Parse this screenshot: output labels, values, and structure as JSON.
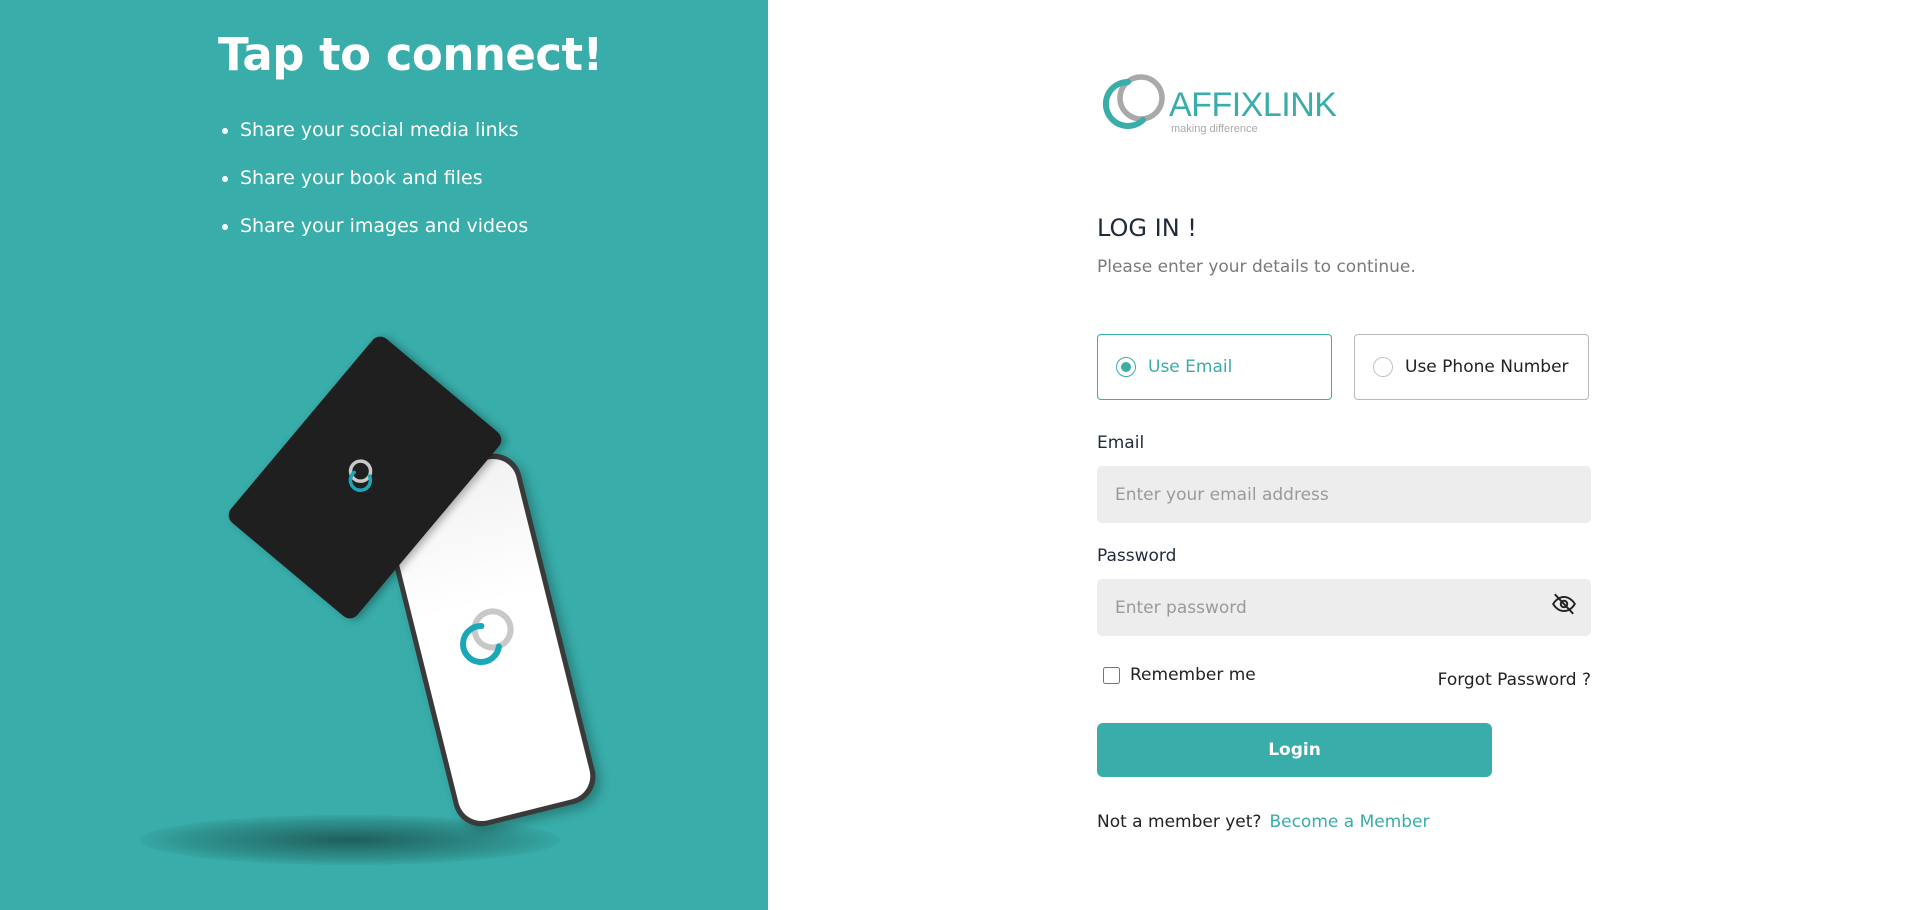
{
  "promo": {
    "headline": "Tap to connect!",
    "bullets": [
      "Share your social media links",
      "Share your book and files",
      "Share your images and videos"
    ],
    "background_color": "#38ada9"
  },
  "logo": {
    "brand": "AFFIXLINK",
    "tagline": "making difference"
  },
  "login": {
    "title": "LOG IN !",
    "subtitle": "Please enter your details to continue.",
    "methods": [
      {
        "label": "Use Email",
        "selected": true
      },
      {
        "label": "Use Phone Number",
        "selected": false
      }
    ],
    "email": {
      "label": "Email",
      "placeholder": "Enter your email address",
      "value": ""
    },
    "password": {
      "label": "Password",
      "placeholder": "Enter password",
      "value": "",
      "toggle_icon": "eye-off-icon"
    },
    "remember_label": "Remember me",
    "remember_checked": false,
    "forgot_label": "Forgot Password ?",
    "submit_label": "Login",
    "member_prompt": "Not a member yet?",
    "member_link": "Become a Member",
    "accent_color": "#38ada9"
  }
}
